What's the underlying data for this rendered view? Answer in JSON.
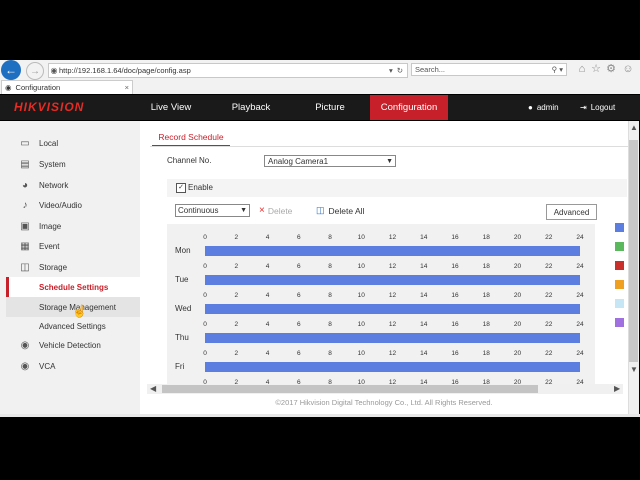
{
  "browser": {
    "url": "http://192.168.1.64/doc/page/config.asp",
    "search_placeholder": "Search...",
    "tab_title": "Configuration"
  },
  "header": {
    "logo": "HIKVISION",
    "nav": [
      "Live View",
      "Playback",
      "Picture",
      "Configuration"
    ],
    "active_nav": "Configuration",
    "user": "admin",
    "logout": "Logout",
    "accent_color": "#c8202a"
  },
  "sidebar": {
    "items": [
      {
        "label": "Local",
        "icon": "monitor-icon"
      },
      {
        "label": "System",
        "icon": "system-icon"
      },
      {
        "label": "Network",
        "icon": "globe-icon"
      },
      {
        "label": "Video/Audio",
        "icon": "microphone-icon"
      },
      {
        "label": "Image",
        "icon": "image-icon"
      },
      {
        "label": "Event",
        "icon": "calendar-icon"
      },
      {
        "label": "Storage",
        "icon": "storage-icon"
      }
    ],
    "storage_sub": [
      "Schedule Settings",
      "Storage Management",
      "Advanced Settings"
    ],
    "active_sub": "Schedule Settings",
    "more_items": [
      {
        "label": "Vehicle Detection",
        "icon": "vehicle-detection-icon"
      },
      {
        "label": "VCA",
        "icon": "vca-icon"
      }
    ]
  },
  "main": {
    "tab": "Record Schedule",
    "channel_label": "Channel No.",
    "channel_value": "Analog Camera1",
    "enable_label": "Enable",
    "enable_checked": true,
    "mode_value": "Continuous",
    "delete_label": "Delete",
    "delete_all_label": "Delete All",
    "advanced_label": "Advanced",
    "days": [
      "Mon",
      "Tue",
      "Wed",
      "Thu",
      "Fri"
    ],
    "ticks": [
      "0",
      "2",
      "4",
      "6",
      "8",
      "10",
      "12",
      "14",
      "16",
      "18",
      "20",
      "22",
      "24"
    ],
    "bar_color": "#5b7ee0",
    "legend_colors": [
      "#5b7ee0",
      "#5cb85c",
      "#c9302c",
      "#f0a020",
      "#c6e6f6",
      "#a070e0"
    ],
    "footer": "©2017 Hikvision Digital Technology Co., Ltd. All Rights Reserved."
  }
}
